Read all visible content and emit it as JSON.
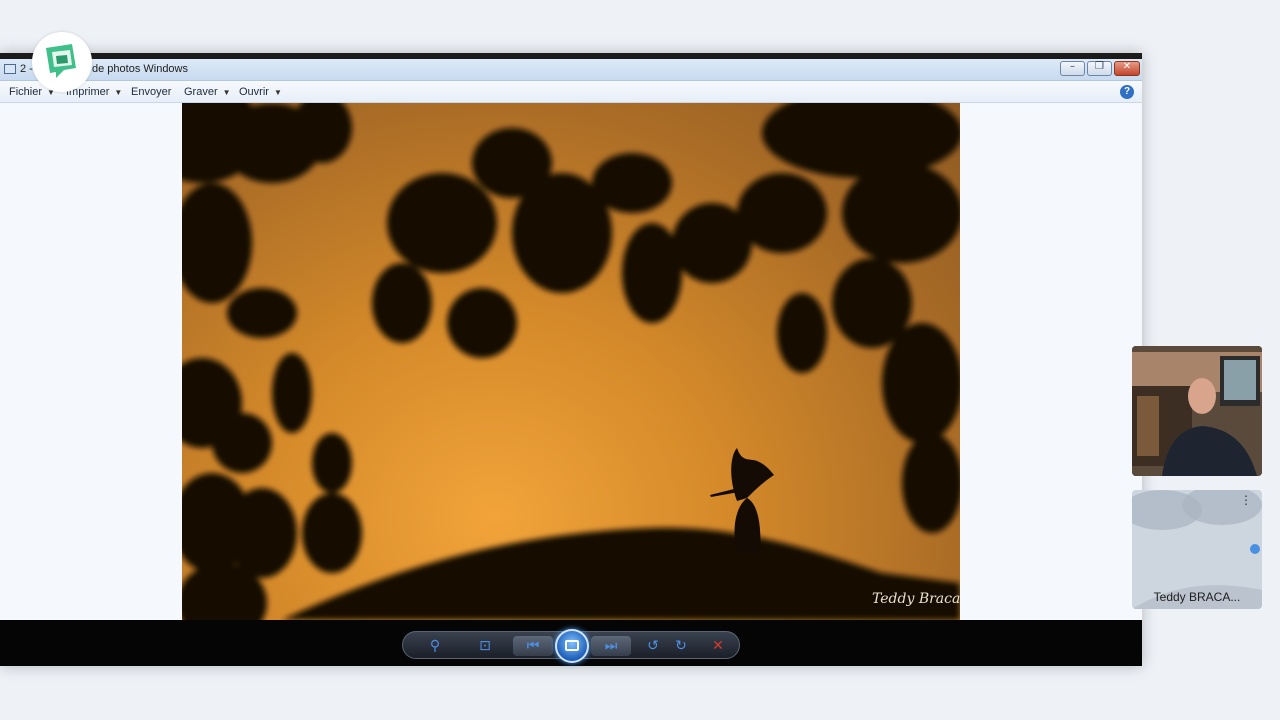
{
  "window": {
    "title_prefix": "2 -",
    "title_suffix": "de photos Windows",
    "controls": {
      "minimize": "–",
      "restore": "❐",
      "close": "✕"
    }
  },
  "menubar": {
    "items": [
      {
        "label": "Fichier",
        "has_caret": true
      },
      {
        "label": "Imprimer",
        "has_caret": true
      },
      {
        "label": "Envoyer",
        "has_caret": false
      },
      {
        "label": "Graver",
        "has_caret": true
      },
      {
        "label": "Ouvrir",
        "has_caret": true
      }
    ],
    "help_label": "?"
  },
  "photo": {
    "signature": "Teddy Bracard"
  },
  "viewer_controls": {
    "zoom_icon": "magnifier-icon",
    "fit_icon": "actual-size-icon",
    "prev_icon": "previous-icon",
    "slideshow_icon": "slideshow-icon",
    "next_icon": "next-icon",
    "rotate_left_icon": "rotate-ccw-icon",
    "rotate_right_icon": "rotate-cw-icon",
    "delete_icon": "delete-icon"
  },
  "participants": [
    {
      "name": "Teddy BRACA..."
    }
  ],
  "colors": {
    "accent": "#4e8fe6",
    "sky_orange": "#d58a2a",
    "logo_green": "#3fbf8a"
  }
}
